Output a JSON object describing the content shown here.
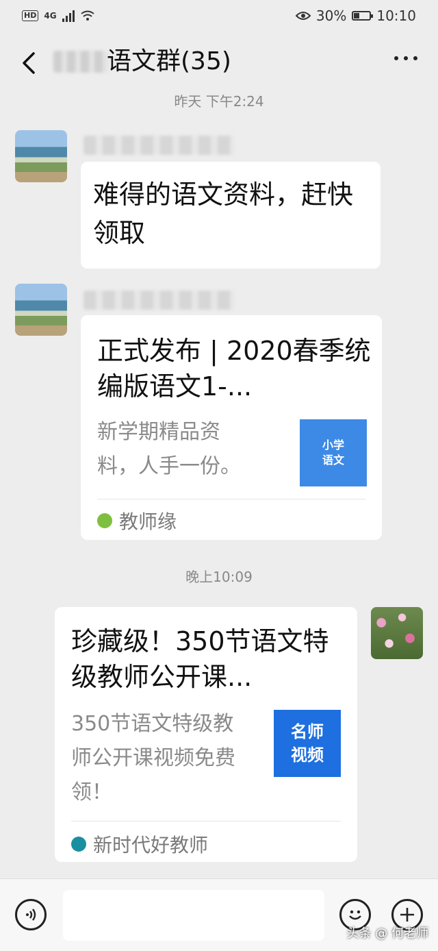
{
  "status_bar": {
    "hd": "HD",
    "network": "4G",
    "battery": "30%",
    "battery_level": 0.3,
    "time": "10:10"
  },
  "header": {
    "title": "语文群(35)"
  },
  "timestamps": [
    "昨天 下午2:24",
    "晚上10:09"
  ],
  "messages": {
    "m1": {
      "text": "难得的语文资料，赶快领取"
    },
    "m2": {
      "title": "正式发布 | 2020春季统编版语文1-...",
      "desc": "新学期精品资料，人手一份。",
      "thumb_text": "小学语文",
      "thumb_color": "#3d8ae6",
      "source": "教师缘"
    },
    "m3": {
      "title": "珍藏级！350节语文特级教师公开课...",
      "desc": "350节语文特级教师公开课视频免费领！",
      "thumb_text": "名师视频",
      "thumb_color": "#1e6fe0",
      "source": "新时代好教师"
    }
  },
  "input_bar": {
    "voice_icon": "voice-icon",
    "emoji_icon": "emoji-icon",
    "plus_icon": "plus-icon"
  },
  "watermark": "头条 @ 何老师"
}
